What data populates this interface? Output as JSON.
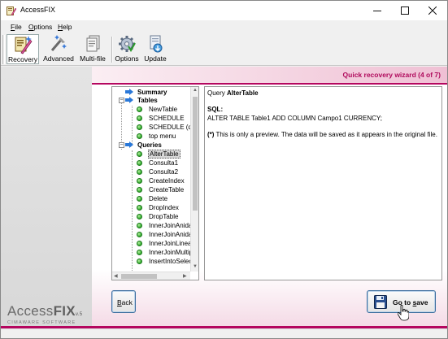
{
  "window": {
    "title": "AccessFIX"
  },
  "menu": [
    "File",
    "Options",
    "Help"
  ],
  "toolbar": [
    {
      "label": "Recovery",
      "icon": "recovery-icon",
      "active": true
    },
    {
      "label": "Advanced",
      "icon": "advanced-icon",
      "active": false
    },
    {
      "label": "Multi-file",
      "icon": "multi-file-icon",
      "active": false
    },
    {
      "label": "Options",
      "icon": "options-gear-icon",
      "active": false
    },
    {
      "label": "Update",
      "icon": "update-icon",
      "active": false
    }
  ],
  "wizard": {
    "title": "Quick recovery wizard (4 of 7)"
  },
  "tree": {
    "summary": "Summary",
    "tables_label": "Tables",
    "tables": [
      "NewTable",
      "SCHEDULE",
      "SCHEDULE (de",
      "top menu"
    ],
    "queries_label": "Queries",
    "queries": [
      "AlterTable",
      "Consulta1",
      "Consulta2",
      "CreateIndex",
      "CreateTable",
      "Delete",
      "DropIndex",
      "DropTable",
      "InnerJoinAnidac",
      "InnerJoinAnidac",
      "InnerJoinLineal",
      "InnerJoinMultiple",
      "InsertIntoSelect"
    ],
    "selected": "AlterTable"
  },
  "preview": {
    "query_prefix": "Query",
    "query_name": "AlterTable",
    "sql_label": "SQL:",
    "sql_text": "ALTER TABLE Table1 ADD COLUMN Campo1 CURRENCY;",
    "note_marker": "(*)",
    "note_text": "This is only a preview. The data will be saved as it appears in the original file."
  },
  "buttons": {
    "back": "Back",
    "save": "Go to save"
  },
  "logo": {
    "name_a": "Access",
    "name_b": "FIX",
    "version": "v.5",
    "tagline": "CIMAWARE SOFTWARE"
  },
  "colors": {
    "accent": "#b5065f",
    "wizard_title": "#b00a5c"
  }
}
